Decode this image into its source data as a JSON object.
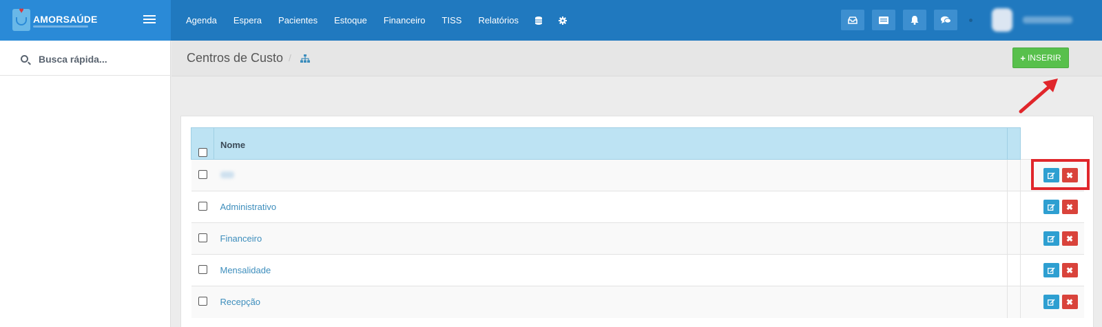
{
  "app": {
    "brand": "AMORSAÚDE"
  },
  "nav": {
    "items": [
      "Agenda",
      "Espera",
      "Pacientes",
      "Estoque",
      "Financeiro",
      "TISS",
      "Relatórios"
    ],
    "icons": [
      "database-icon",
      "gear-icon"
    ]
  },
  "toolbar": {
    "icons": [
      "inbox-icon",
      "list-icon",
      "bell-icon",
      "chat-icon"
    ]
  },
  "sidebar": {
    "search_placeholder": "Busca rápida..."
  },
  "page": {
    "title": "Centros de Custo",
    "breadcrumb_sep": "/",
    "insert_label": "INSERIR"
  },
  "table": {
    "header": "Nome",
    "rows": [
      "",
      "Administrativo",
      "Financeiro",
      "Mensalidade",
      "Recepção"
    ]
  },
  "colors": {
    "topbar": "#2079bf",
    "brand_bg": "#2a8ad7",
    "insert_button": "#58c04c",
    "edit_button": "#2e9fd1",
    "delete_button": "#d9433b",
    "annotation": "#e0262b"
  }
}
